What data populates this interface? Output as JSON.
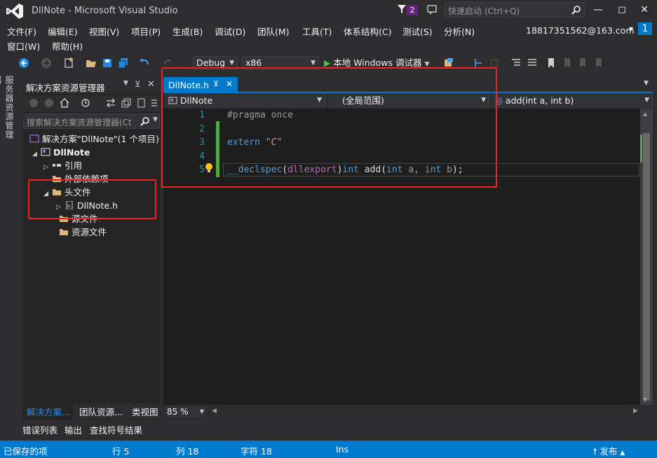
{
  "title_bar": {
    "title": "DllNote - Microsoft Visual Studio",
    "notification_count": "2",
    "quick_launch_placeholder": "快速启动 (Ctrl+Q)"
  },
  "menu": {
    "items": [
      "文件(F)",
      "编辑(E)",
      "视图(V)",
      "项目(P)",
      "生成(B)",
      "调试(D)",
      "团队(M)",
      "工具(T)",
      "体系结构(C)",
      "测试(S)",
      "分析(N)",
      "窗口(W)",
      "帮助(H)"
    ],
    "account": "18817351562@163.com",
    "account_badge": "1"
  },
  "toolbar": {
    "config": "Debug",
    "platform": "x86",
    "run_label": "本地 Windows 调试器"
  },
  "side_tab": "服务器资源管理器",
  "solution_explorer": {
    "title": "解决方案资源管理器",
    "search_placeholder": "搜索解决方案资源管理器(Ctrl",
    "tree": [
      {
        "label": "解决方案\"DllNote\"(1 个项目)"
      },
      {
        "label": "DllNote"
      },
      {
        "label": "引用"
      },
      {
        "label": "外部依赖项"
      },
      {
        "label": "头文件"
      },
      {
        "label": "DllNote.h"
      },
      {
        "label": "源文件"
      },
      {
        "label": "资源文件"
      }
    ],
    "tabs": [
      "解决方案...",
      "团队资源...",
      "类视图"
    ]
  },
  "editor": {
    "tab_label": "DllNote.h",
    "nav_project": "DllNote",
    "nav_scope": "(全局范围)",
    "nav_member": "add(int a, int b)",
    "line_numbers": [
      "1",
      "2",
      "3",
      "4",
      "5"
    ],
    "code": {
      "l1": "#pragma once",
      "l3_kw": "extern",
      "l3_str": "\"C\"",
      "l5_decl": "__declspec",
      "l5_p1": "(",
      "l5_arg": "dllexport",
      "l5_p2": ")",
      "l5_int1": "int",
      "l5_fn": "add",
      "l5_p3": "(",
      "l5_int2": "int",
      "l5_a": "a,",
      "l5_int3": "int",
      "l5_b": "b",
      "l5_end": ");"
    },
    "zoom": "85 %"
  },
  "output_tabs": [
    "错误列表",
    "输出",
    "查找符号结果"
  ],
  "status_bar": {
    "state": "已保存的项",
    "line": "行 5",
    "col": "列 18",
    "char": "字符 18",
    "mode": "Ins",
    "publish": "发布"
  },
  "colors": {
    "accent": "#007acc",
    "highlight_border": "#e22222"
  }
}
